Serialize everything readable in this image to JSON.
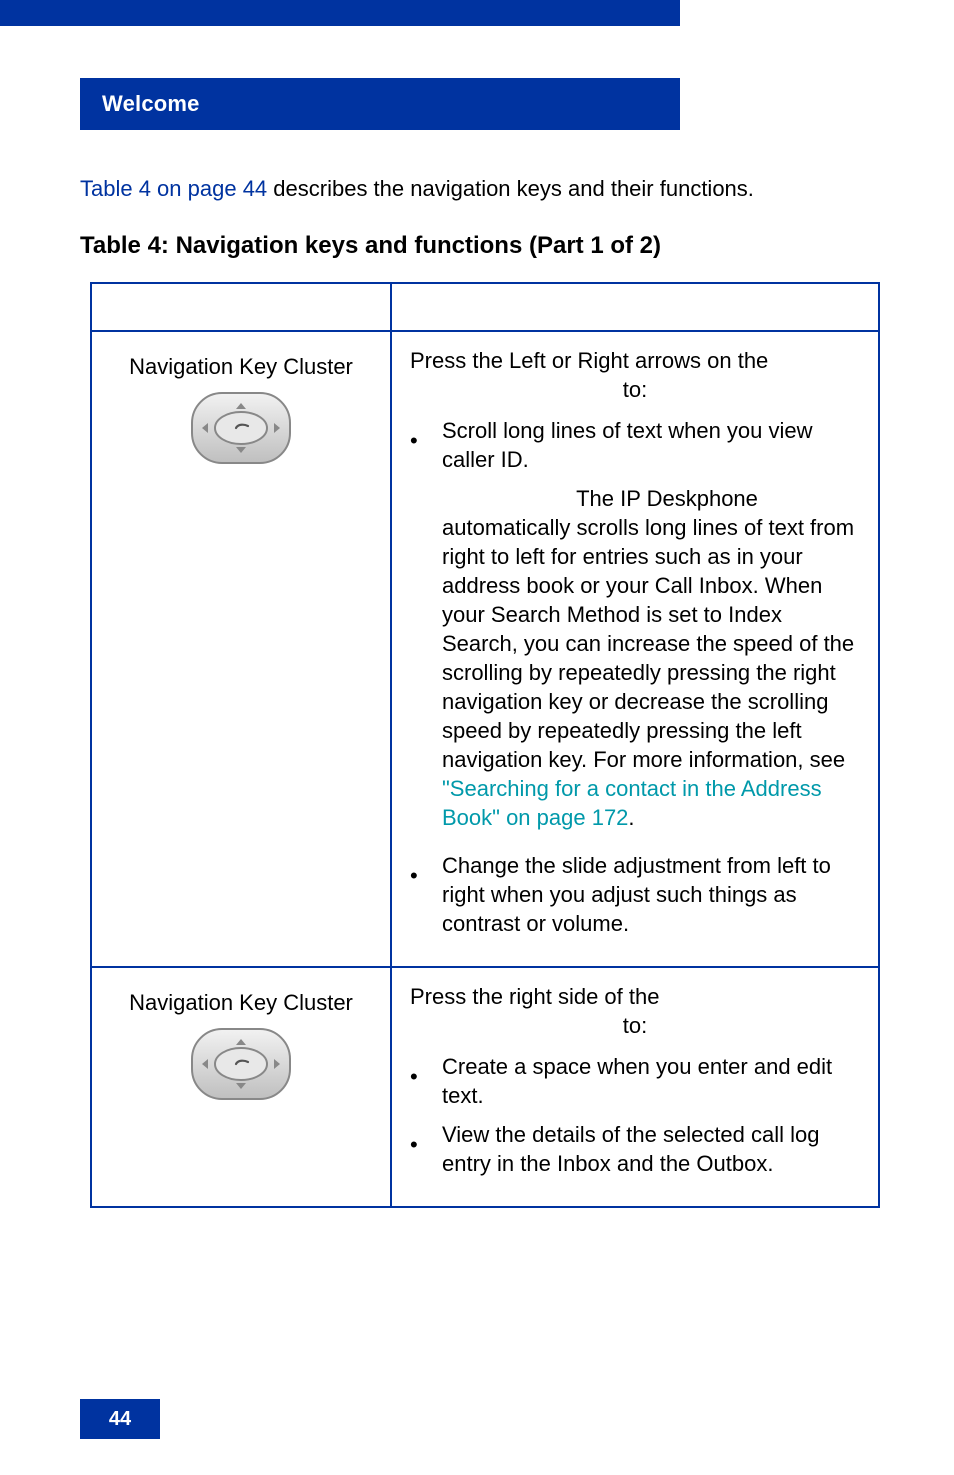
{
  "header": {
    "section_title": "Welcome"
  },
  "intro": {
    "link_text": "Table 4 on page 44",
    "rest": " describes the navigation keys and their functions."
  },
  "table": {
    "caption": "Table 4: Navigation keys and functions (Part 1 of 2)",
    "rows": [
      {
        "label": "Navigation Key Cluster",
        "head_line1": "Press the Left or Right arrows on the",
        "head_line2": "to:",
        "bullet1": "Scroll long lines of text when you view caller ID.",
        "sub_first": "The IP Deskphone",
        "sub_rest_before_link": "automatically scrolls long lines of text from right to left for entries such as in your address book or your Call Inbox. When your Search Method is set to Index Search, you can increase the speed of the scrolling by repeatedly pressing the right navigation key or decrease the scrolling speed by repeatedly pressing the left navigation key. For more information, see ",
        "sub_link": "\"Searching for a contact in the Address Book\" on page 172",
        "sub_after_link": ".",
        "bullet2": "Change the slide adjustment from left to right when you adjust such things as contrast or volume."
      },
      {
        "label": "Navigation Key Cluster",
        "head_line1": "Press the right side of the",
        "head_line2": "to:",
        "bullet1": "Create a space when you enter and edit text.",
        "bullet2": "View the details of the selected call log entry in the Inbox and the Outbox."
      }
    ]
  },
  "footer": {
    "page_number": "44"
  }
}
